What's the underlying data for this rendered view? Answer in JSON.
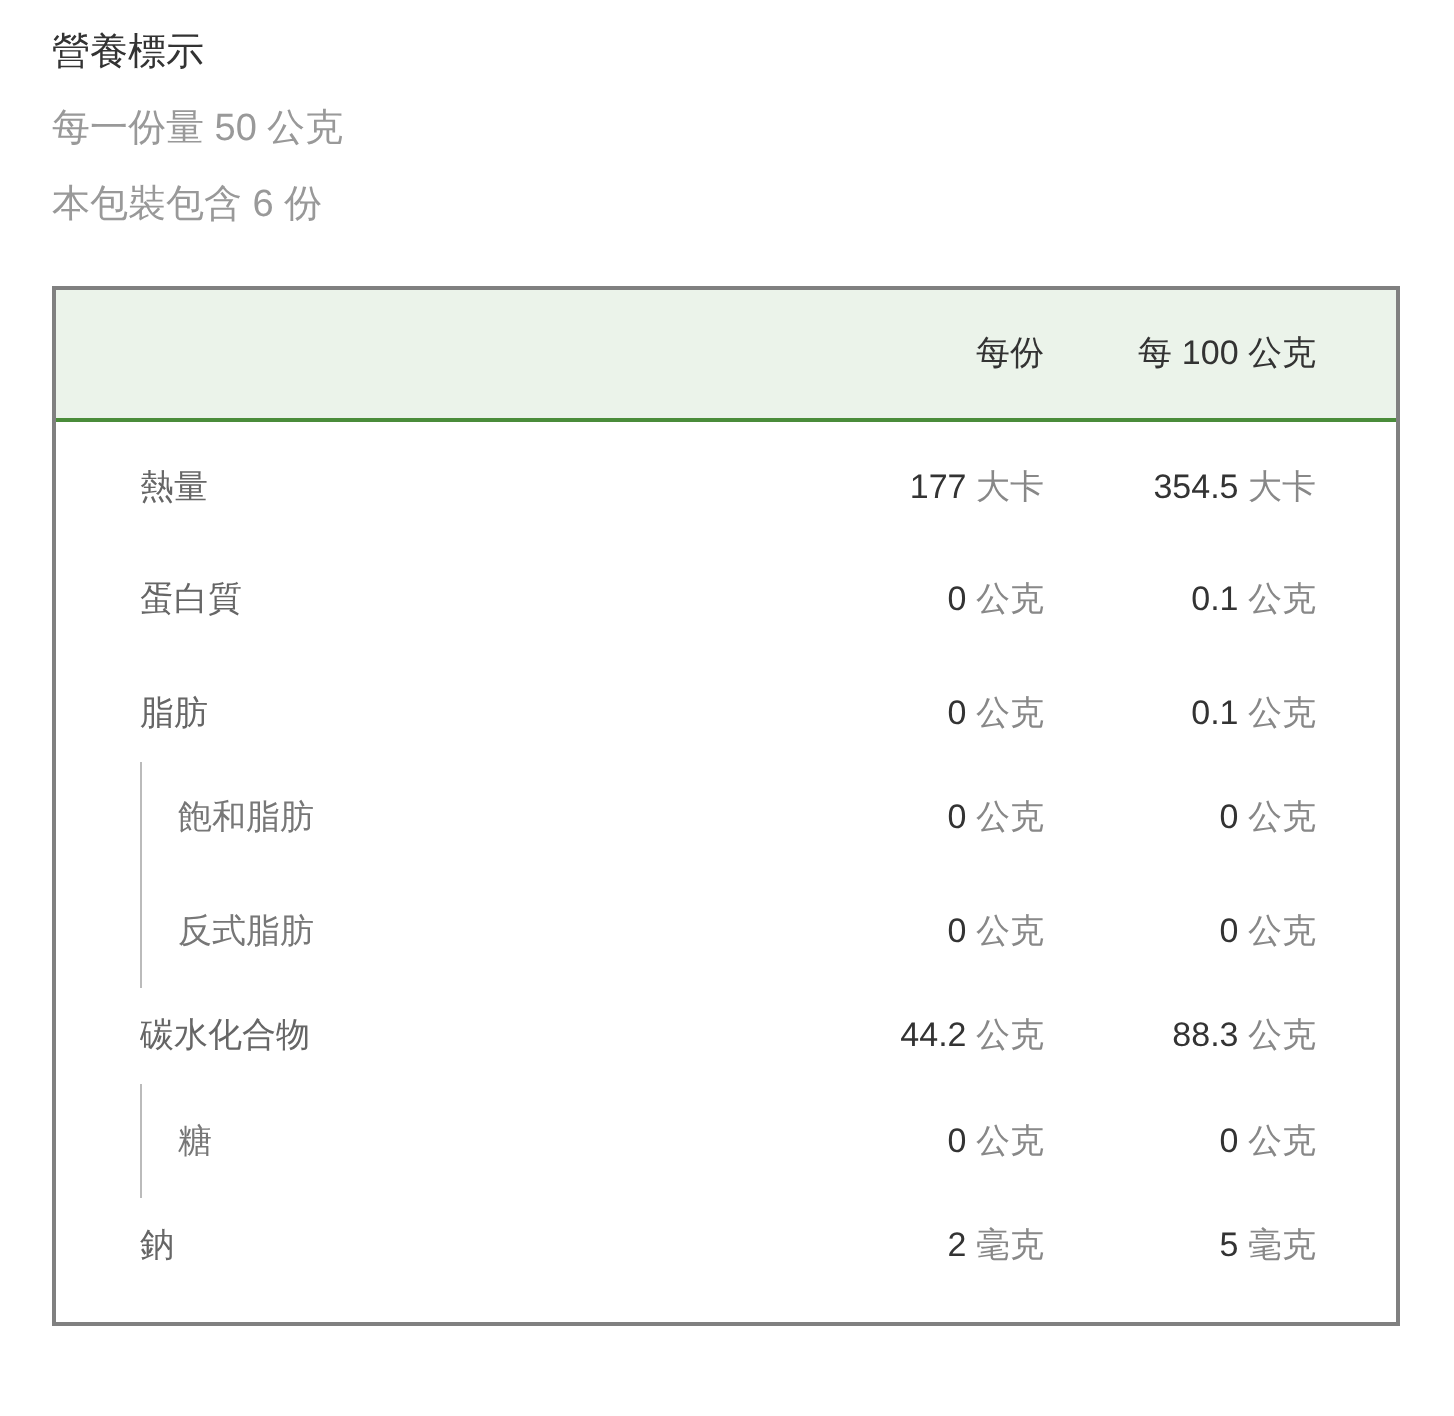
{
  "title": "營養標示",
  "serving_size": "每一份量 50 公克",
  "servings": "本包裝包含 6 份",
  "table": {
    "columns": [
      "每份",
      "每 100 公克"
    ],
    "rows": [
      {
        "name": "熱量",
        "per_serving": {
          "amount": "177",
          "unit": "大卡"
        },
        "per_100g": {
          "amount": "354.5",
          "unit": "大卡"
        }
      },
      {
        "name": "蛋白質",
        "per_serving": {
          "amount": "0",
          "unit": "公克"
        },
        "per_100g": {
          "amount": "0.1",
          "unit": "公克"
        }
      },
      {
        "name": "脂肪",
        "per_serving": {
          "amount": "0",
          "unit": "公克"
        },
        "per_100g": {
          "amount": "0.1",
          "unit": "公克"
        },
        "children": [
          {
            "name": "飽和脂肪",
            "per_serving": {
              "amount": "0",
              "unit": "公克"
            },
            "per_100g": {
              "amount": "0",
              "unit": "公克"
            }
          },
          {
            "name": "反式脂肪",
            "per_serving": {
              "amount": "0",
              "unit": "公克"
            },
            "per_100g": {
              "amount": "0",
              "unit": "公克"
            }
          }
        ]
      },
      {
        "name": "碳水化合物",
        "per_serving": {
          "amount": "44.2",
          "unit": "公克"
        },
        "per_100g": {
          "amount": "88.3",
          "unit": "公克"
        },
        "children": [
          {
            "name": "糖",
            "per_serving": {
              "amount": "0",
              "unit": "公克"
            },
            "per_100g": {
              "amount": "0",
              "unit": "公克"
            }
          }
        ]
      },
      {
        "name": "鈉",
        "per_serving": {
          "amount": "2",
          "unit": "毫克"
        },
        "per_100g": {
          "amount": "5",
          "unit": "毫克"
        }
      }
    ]
  }
}
